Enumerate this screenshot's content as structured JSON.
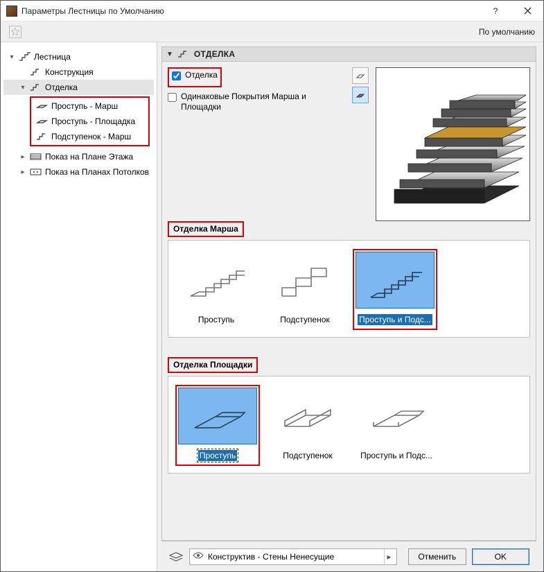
{
  "window": {
    "title": "Параметры Лестницы по Умолчанию"
  },
  "topbar": {
    "default_label": "По умолчанию"
  },
  "tree": {
    "root": "Лестница",
    "construction": "Конструкция",
    "finish": "Отделка",
    "finish_children": {
      "tread_flight": "Проступь - Марш",
      "tread_landing": "Проступь - Площадка",
      "riser_flight": "Подступенок - Марш"
    },
    "floor_plan": "Показ на Плане Этажа",
    "ceiling_plan": "Показ на Планах Потолков"
  },
  "panel": {
    "title": "ОТДЕЛКА"
  },
  "checkboxes": {
    "finish_label": "Отделка",
    "same_cover_label": "Одинаковые Покрытия Марша и Площадки"
  },
  "sections": {
    "flight_finish": "Отделка Марша",
    "landing_finish": "Отделка Площадки"
  },
  "options": {
    "tread": "Проступь",
    "riser": "Подступенок",
    "tread_and_riser": "Проступь и Подс..."
  },
  "footer": {
    "layer": "Конструктив - Стены Ненесущие",
    "cancel": "Отменить",
    "ok": "OK"
  }
}
